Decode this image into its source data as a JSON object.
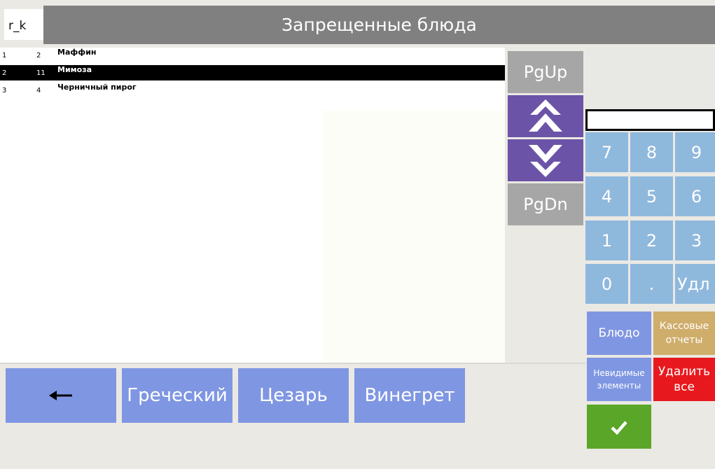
{
  "header": {
    "title": "Запрещенные блюда",
    "corner_label": "r_k"
  },
  "list": {
    "rows": [
      {
        "index": "1",
        "code": "2",
        "name": "Маффин",
        "selected": false
      },
      {
        "index": "2",
        "code": "11",
        "name": "Мимоза",
        "selected": true
      },
      {
        "index": "3",
        "code": "4",
        "name": "Черничный пирог",
        "selected": false
      }
    ]
  },
  "paging": {
    "pgup": "PgUp",
    "up_icon": "double-chevron-up",
    "down_icon": "double-chevron-down",
    "pgdn": "PgDn"
  },
  "keypad": {
    "display_value": "",
    "input_value": "",
    "keys": [
      "7",
      "8",
      "9",
      "4",
      "5",
      "6",
      "1",
      "2",
      "3",
      "0",
      ".",
      "Удл"
    ]
  },
  "functions": {
    "dish": "Блюдо",
    "cash_reports_1": "Кассовые",
    "cash_reports_2": "отчеты",
    "invisible_1": "Невидимые",
    "invisible_2": "элементы",
    "delete_all_1": "Удалить",
    "delete_all_2": "все",
    "confirm_icon": "checkmark"
  },
  "bottom": {
    "back_icon": "arrow-left",
    "buttons": [
      "Греческий",
      "Цезарь",
      "Винегрет"
    ]
  },
  "colors": {
    "header": "#808080",
    "selected_row": "#000000",
    "key": "#8fb8dd",
    "nav_purple": "#6b53a8",
    "paging_gray": "#a6a6a6",
    "bottom_button": "#7f96e2",
    "function_blue": "#7f96e2",
    "cash_reports": "#cfad6b",
    "delete_all": "#e8191e",
    "confirm": "#5aa629"
  }
}
